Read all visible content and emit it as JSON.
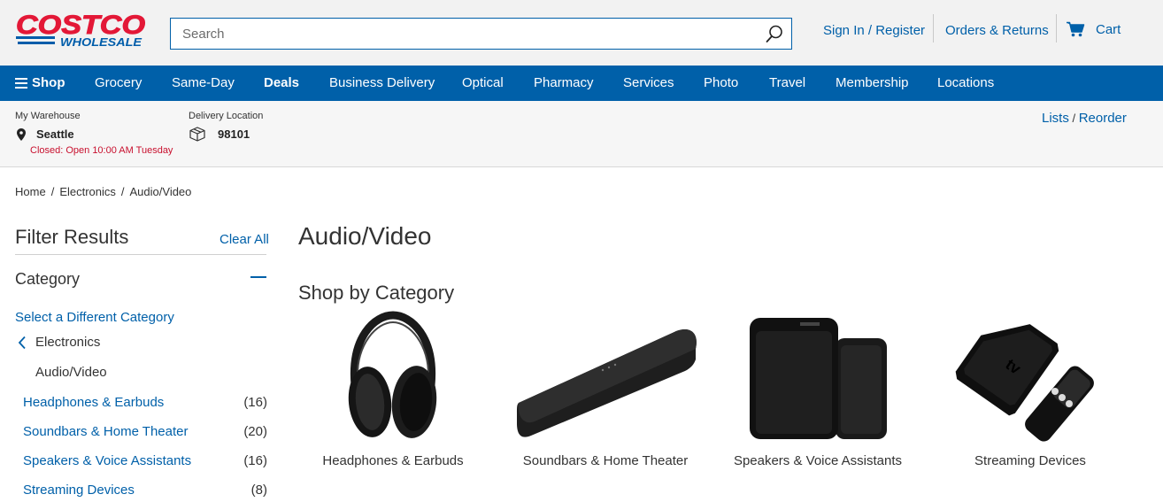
{
  "header": {
    "logo_top": "COSTCO",
    "logo_bottom": "WHOLESALE",
    "search_placeholder": "Search",
    "sign_in": "Sign In / Register",
    "orders": "Orders & Returns",
    "cart": "Cart"
  },
  "nav": {
    "shop": "Shop",
    "items": [
      "Grocery",
      "Same-Day",
      "Deals",
      "Business Delivery",
      "Optical",
      "Pharmacy",
      "Services",
      "Photo",
      "Travel",
      "Membership",
      "Locations"
    ]
  },
  "location": {
    "warehouse_label": "My Warehouse",
    "warehouse": "Seattle",
    "status": "Closed: Open 10:00 AM Tuesday",
    "delivery_label": "Delivery Location",
    "zip": "98101",
    "lists": "Lists",
    "reorder": "Reorder"
  },
  "breadcrumb": [
    "Home",
    "Electronics",
    "Audio/Video"
  ],
  "sidebar": {
    "title": "Filter Results",
    "clear_all": "Clear All",
    "category": "Category",
    "select_different": "Select a Different Category",
    "parent": "Electronics",
    "current": "Audio/Video",
    "items": [
      {
        "label": "Headphones & Earbuds",
        "count": "(16)"
      },
      {
        "label": "Soundbars & Home Theater",
        "count": "(20)"
      },
      {
        "label": "Speakers & Voice Assistants",
        "count": "(16)"
      },
      {
        "label": "Streaming Devices",
        "count": "(8)"
      }
    ]
  },
  "main": {
    "title": "Audio/Video",
    "shop_by": "Shop by Category",
    "tiles": [
      {
        "label": "Headphones & Earbuds"
      },
      {
        "label": "Soundbars & Home Theater"
      },
      {
        "label": "Speakers & Voice Assistants"
      },
      {
        "label": "Streaming Devices",
        "brand_text": "tv"
      }
    ]
  },
  "colors": {
    "brand_red": "#e31837",
    "brand_blue": "#0060a9",
    "closed_red": "#c8102e"
  }
}
